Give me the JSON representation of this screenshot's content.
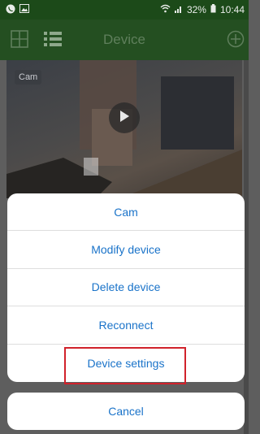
{
  "status_bar": {
    "battery": "32%",
    "time": "10:44"
  },
  "app_bar": {
    "title": "Device"
  },
  "video": {
    "camera_label": "Cam"
  },
  "action_sheet": {
    "items": [
      {
        "label": "Cam"
      },
      {
        "label": "Modify device"
      },
      {
        "label": "Delete device"
      },
      {
        "label": "Reconnect"
      },
      {
        "label": "Device settings"
      }
    ],
    "cancel_label": "Cancel"
  },
  "colors": {
    "accent_green": "#244f21",
    "action_blue": "#1a73c9",
    "highlight_red": "#d1222b"
  }
}
